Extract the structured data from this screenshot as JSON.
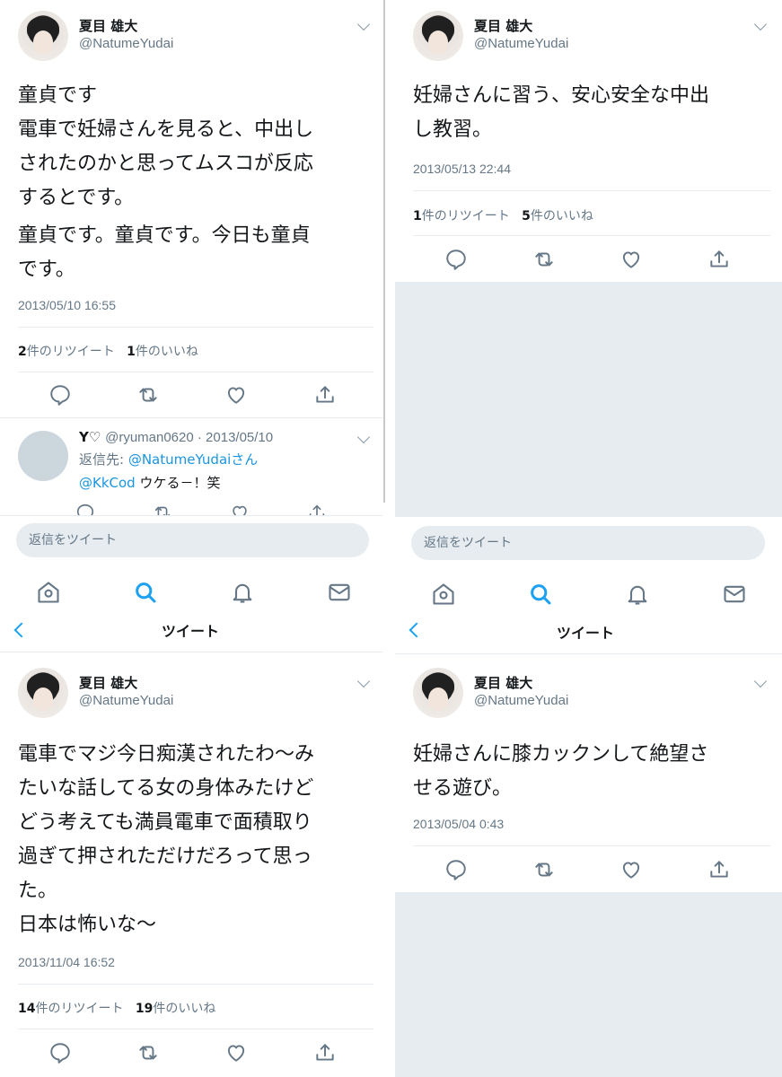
{
  "user": {
    "name": "夏目 雄大",
    "handle": "@NatumeYudai"
  },
  "panel_tl": {
    "text_1": "童貞です\n電車で妊婦さんを見ると、中出し\nされたのかと思ってムスコが反応\nするとです。",
    "text_2": "童貞です。童貞です。今日も童貞\nです。",
    "timestamp": "2013/05/10 16:55",
    "retweets_count": "2",
    "retweets_label": "件のリツイート",
    "likes_count": "1",
    "likes_label": "件のいいね",
    "reply": {
      "name": "Y♡",
      "handle_date": "@ryuman0620 · 2013/05/10",
      "reply_to_prefix": "返信先: ",
      "reply_to_users": "@NatumeYudaiさん",
      "mention": "@KkCod",
      "text": " ウケる－！笑"
    }
  },
  "panel_tr": {
    "text": "妊婦さんに習う、安心安全な中出\nし教習。",
    "timestamp": "2013/05/13 22:44",
    "retweets_count": "1",
    "retweets_label": "件のリツイート",
    "likes_count": "5",
    "likes_label": "件のいいね"
  },
  "reply_placeholder": "返信をツイート",
  "header_title": "ツイート",
  "panel_bl": {
    "text_1": "電車でマジ今日痴漢されたわ〜み\nたいな話してる女の身体みたけど\nどう考えても満員電車で面積取り\n過ぎて押されただけだろって思っ\nた。",
    "text_2": "日本は怖いな〜",
    "timestamp": "2013/11/04 16:52",
    "retweets_count": "14",
    "retweets_label": "件のリツイート",
    "likes_count": "19",
    "likes_label": "件のいいね"
  },
  "panel_br": {
    "text": "妊婦さんに膝カックンして絶望さ\nせる遊び。",
    "timestamp": "2013/05/04 0:43"
  },
  "colors": {
    "accent": "#1da1f2",
    "muted": "#657786",
    "border": "#e6ecf0"
  }
}
